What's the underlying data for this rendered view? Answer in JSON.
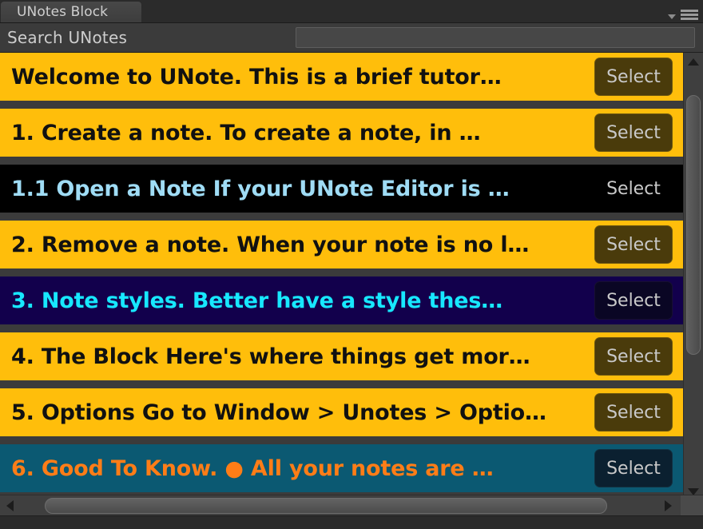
{
  "window": {
    "tab_label": "UNotes Block",
    "menu_caret_icon": "chevron-down-icon",
    "menu_burger_icon": "hamburger-menu-icon"
  },
  "search": {
    "label": "Search UNotes",
    "value": "",
    "placeholder": ""
  },
  "colors": {
    "panel_bg": "#3b3b3b",
    "tab_bg": "#424242",
    "note_yellow": "#ffbe0b",
    "note_black": "#000000",
    "note_navy": "#12004c",
    "note_teal": "#0b5972",
    "text_black": "#111111",
    "text_lightblue": "#9fdcf5",
    "text_cyan": "#17e8ff",
    "text_orange": "#ff7d17",
    "button_olive": "#4a3b0b",
    "button_navy": "#0a0624",
    "button_darkteal": "#0b2030",
    "button_text": "#c9c9c9"
  },
  "notes": [
    {
      "title": "Welcome to UNote.  This is a brief tutor…",
      "bg": "#ffbe0b",
      "fg": "#111111",
      "btn_bg": "#4a3b0b",
      "btn_border": "#6a5510",
      "select_label": "Select"
    },
    {
      "title": "1. Create a note.  To create a note, in …",
      "bg": "#ffbe0b",
      "fg": "#111111",
      "btn_bg": "#4a3b0b",
      "btn_border": "#6a5510",
      "select_label": "Select"
    },
    {
      "title": "1.1 Open a Note If your UNote Editor is …",
      "bg": "#000000",
      "fg": "#9fdcf5",
      "btn_bg": "#000000",
      "btn_border": "#000000",
      "select_label": "Select"
    },
    {
      "title": "2. Remove a note. When your note is no l…",
      "bg": "#ffbe0b",
      "fg": "#111111",
      "btn_bg": "#4a3b0b",
      "btn_border": "#6a5510",
      "select_label": "Select"
    },
    {
      "title": "3. Note styles. Better have a style thes…",
      "bg": "#12004c",
      "fg": "#17e8ff",
      "btn_bg": "#0a0624",
      "btn_border": "#17102f",
      "select_label": "Select"
    },
    {
      "title": "4. The Block Here's where things get mor…",
      "bg": "#ffbe0b",
      "fg": "#111111",
      "btn_bg": "#4a3b0b",
      "btn_border": "#6a5510",
      "select_label": "Select"
    },
    {
      "title": "5. Options Go to Window > Unotes > Optio…",
      "bg": "#ffbe0b",
      "fg": "#111111",
      "btn_bg": "#4a3b0b",
      "btn_border": "#6a5510",
      "select_label": "Select"
    },
    {
      "title": "6. Good To Know.   ● All your notes are …",
      "bg": "#0b5972",
      "fg": "#ff7d17",
      "btn_bg": "#0b2030",
      "btn_border": "#133040",
      "select_label": "Select"
    }
  ],
  "scrollbars": {
    "vertical": {
      "up_icon": "triangle-up-icon",
      "down_icon": "triangle-down-icon",
      "thumb_top_pct": 6,
      "thumb_height_pct": 63
    },
    "horizontal": {
      "left_icon": "triangle-left-icon",
      "right_icon": "triangle-right-icon",
      "thumb_left_pct": 4,
      "thumb_width_pct": 88
    }
  }
}
